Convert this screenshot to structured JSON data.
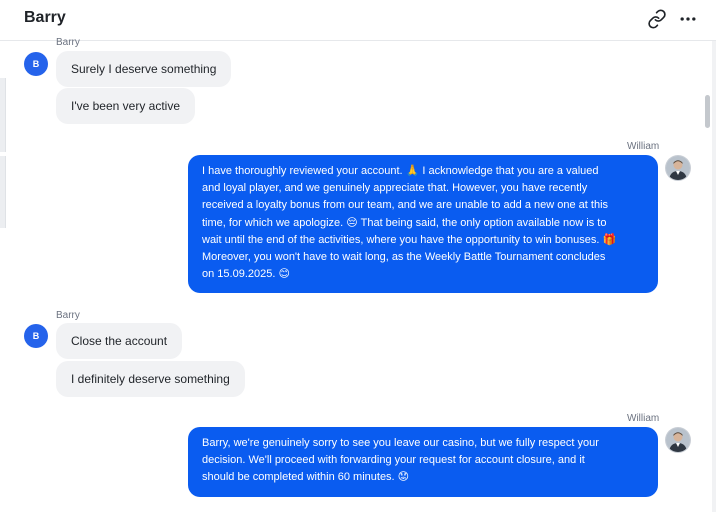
{
  "header": {
    "title": "Barry"
  },
  "icons": {
    "link": "link-icon",
    "more": "more-horizontal-icon"
  },
  "chat": {
    "group1": {
      "sender": "Barry",
      "avatar": "B",
      "messages": [
        "Surely I deserve something",
        "I've been very active"
      ]
    },
    "reply1": {
      "sender": "William",
      "lines": [
        "I have thoroughly reviewed your account. 🙏 I acknowledge that you are a valued",
        "and loyal player, and we genuinely appreciate that. However, you have recently",
        "received a loyalty bonus from our team, and we are unable to add a new one at this",
        "time, for which we apologize. 😔 That being said, the only option available now is to",
        "wait until the end of the activities, where you have the opportunity to win bonuses. 🎁",
        "Moreover, you won't have to wait long, as the Weekly Battle Tournament concludes",
        "on 15.09.2025. 😊"
      ]
    },
    "group2": {
      "sender": "Barry",
      "avatar": "B",
      "messages": [
        "Close the account",
        "I definitely deserve something"
      ]
    },
    "reply2": {
      "sender": "William",
      "lines": [
        "Barry, we're genuinely sorry to see you leave our casino, but we fully respect your",
        "decision. We'll proceed with forwarding your request for account closure, and it",
        "should be completed within 60 minutes. 😟"
      ]
    }
  },
  "colors": {
    "outgoing_bubble": "#0a5cf0",
    "incoming_bubble": "#f1f2f4",
    "avatar_badge": "#2563eb"
  }
}
